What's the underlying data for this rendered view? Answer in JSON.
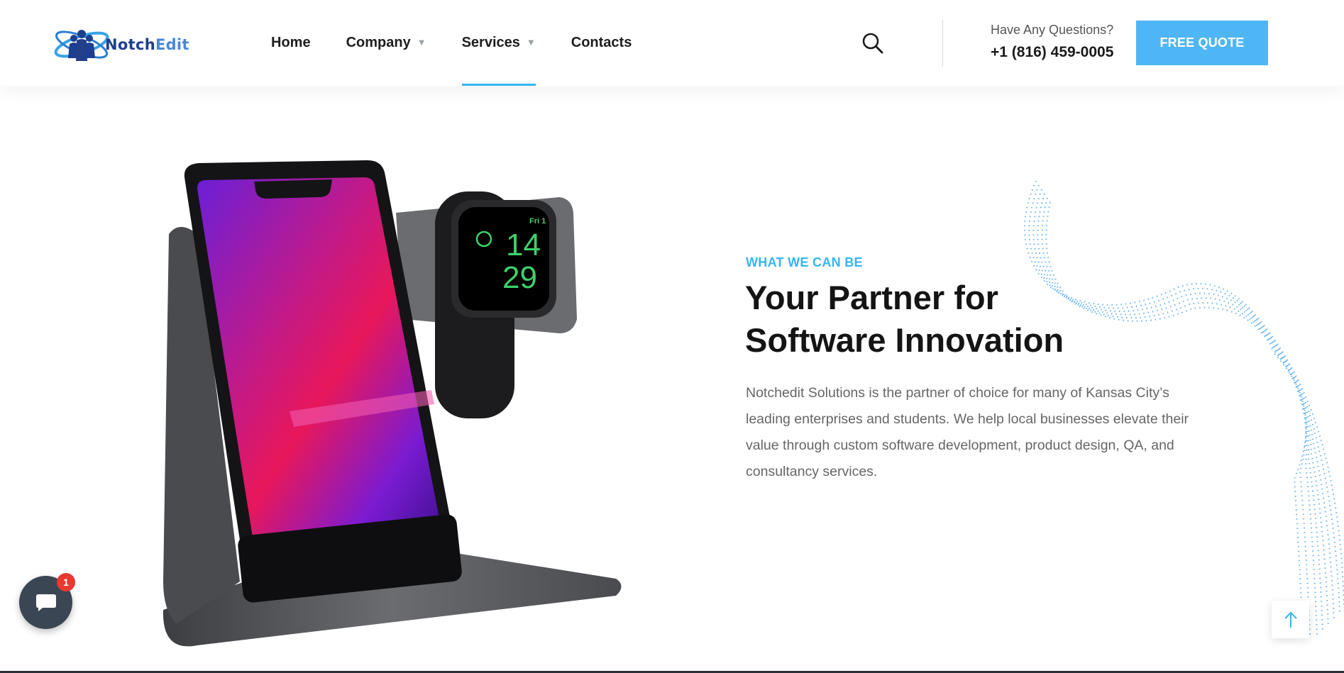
{
  "header": {
    "logo": {
      "text_main": "Notch",
      "text_accent": "Edit"
    },
    "nav": [
      {
        "label": "Home",
        "has_dropdown": false
      },
      {
        "label": "Company",
        "has_dropdown": true
      },
      {
        "label": "Services",
        "has_dropdown": true,
        "active": true
      },
      {
        "label": "Contacts",
        "has_dropdown": false
      }
    ],
    "search_icon": "search-icon",
    "questions_label": "Have Any Questions?",
    "phone": "+1 (816) 459-0005",
    "cta_label": "FREE QUOTE"
  },
  "hero": {
    "eyebrow": "WHAT WE CAN BE",
    "title_line1": "Your Partner for",
    "title_line2": "Software Innovation",
    "body": "Notchedit Solutions is the partner of choice for many of Kansas City’s leading enterprises and students. We help local businesses elevate their value through custom software development, product design, QA, and consultancy services.",
    "watch": {
      "day": "Fri 1",
      "hour": "14",
      "minute": "29"
    }
  },
  "chat_widget": {
    "badge_count": "1",
    "icon": "chat-bubble-icon"
  },
  "scroll_top": {
    "icon": "arrow-up-icon"
  },
  "colors": {
    "accent": "#36b5f2",
    "cta": "#4fb6f5",
    "badge": "#e8382f",
    "chat_bg": "#3b4654"
  }
}
